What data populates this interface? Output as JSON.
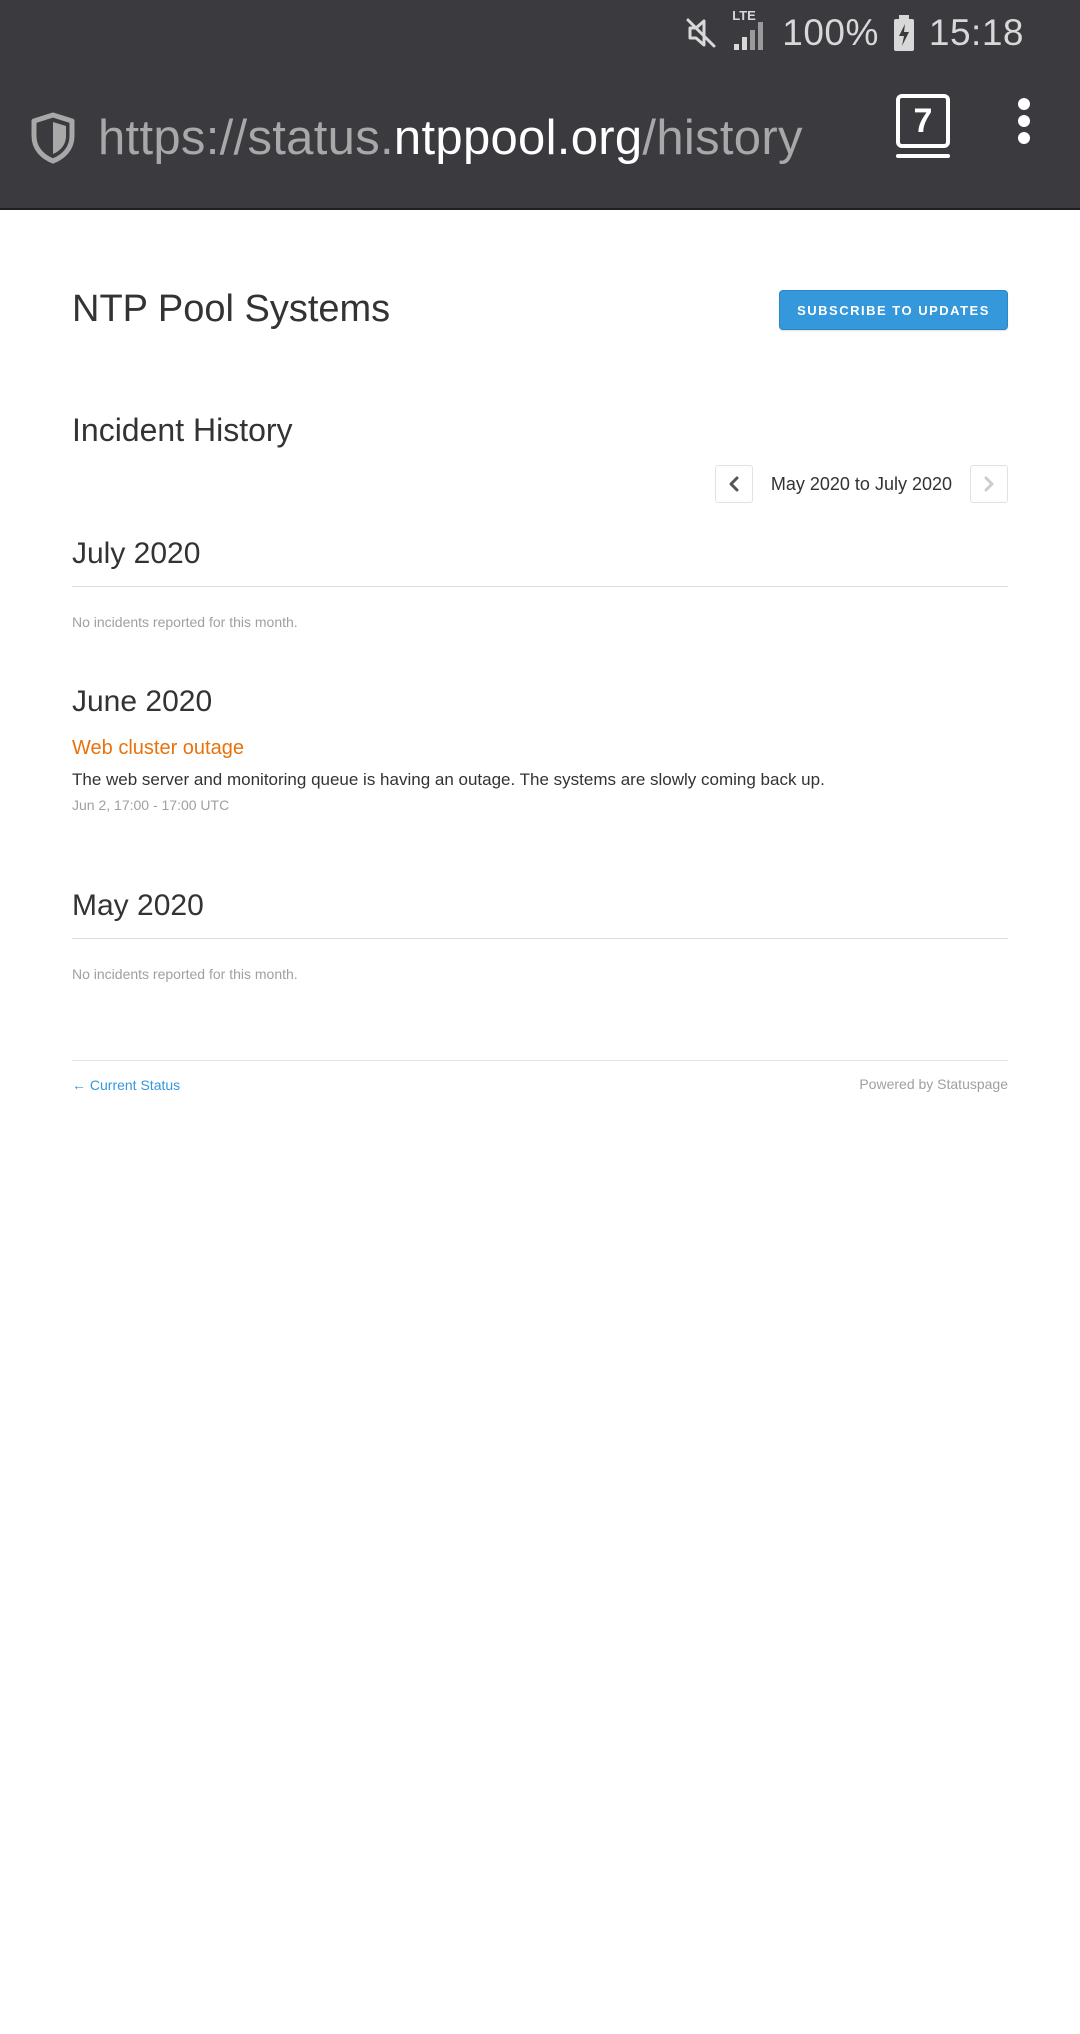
{
  "status_bar": {
    "network_label": "LTE",
    "battery_percent": "100%",
    "time": "15:18",
    "icons": [
      "mute-icon",
      "signal-icon",
      "battery-charging-icon"
    ]
  },
  "browser": {
    "url_prefix": "https://status.",
    "url_host": "ntppool.org",
    "url_path": "/history",
    "tab_count": "7",
    "icons": [
      "shield-icon",
      "tabs-icon",
      "overflow-menu-icon"
    ]
  },
  "header": {
    "title": "NTP Pool Systems",
    "subscribe_label": "SUBSCRIBE TO UPDATES"
  },
  "history": {
    "title": "Incident History",
    "range_label": "May 2020 to July 2020",
    "months": [
      {
        "name": "July 2020",
        "empty_text": "No incidents reported for this month."
      },
      {
        "name": "June 2020",
        "incidents": [
          {
            "title": "Web cluster outage",
            "body": "The web server and monitoring queue is having an outage. The systems are slowly coming back up.",
            "time": "Jun 2, 17:00 - 17:00 UTC"
          }
        ]
      },
      {
        "name": "May 2020",
        "empty_text": "No incidents reported for this month."
      }
    ]
  },
  "footer": {
    "current_status_link": "← Current Status",
    "powered_by": "Powered by Statuspage"
  },
  "colors": {
    "accent_blue": "#3498db",
    "incident_orange": "#e8720c",
    "toolbar_bg": "#3a3a3f"
  }
}
